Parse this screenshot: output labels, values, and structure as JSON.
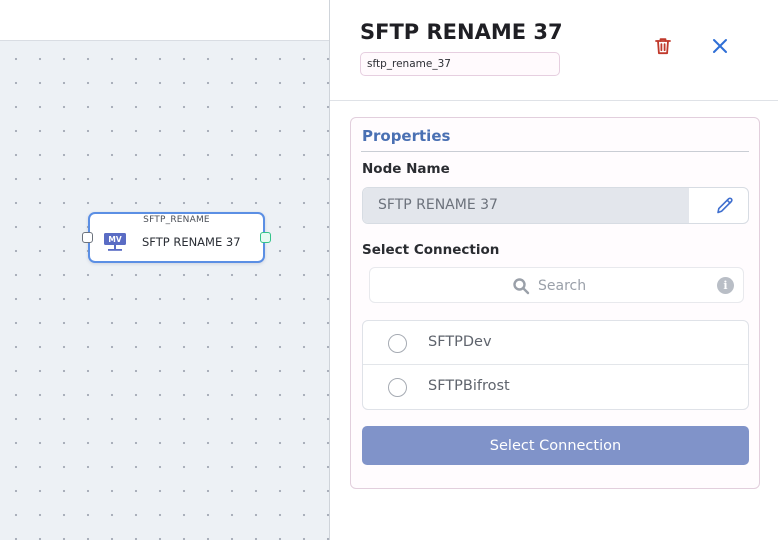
{
  "canvas": {
    "node": {
      "type_label": "SFTP_RENAME",
      "title": "SFTP RENAME 37",
      "icon": "mv-file-transfer-icon",
      "icon_text": "MV"
    }
  },
  "panel": {
    "title": "SFTP RENAME 37",
    "node_id": "sftp_rename_37",
    "delete_icon": "trash-icon",
    "close_icon": "close-icon",
    "properties": {
      "heading": "Properties",
      "node_name_label": "Node Name",
      "node_name_value": "SFTP RENAME 37",
      "edit_icon": "pencil-icon",
      "select_connection_label": "Select Connection",
      "search": {
        "placeholder": "Search",
        "icon": "search-icon",
        "info_icon": "info-icon",
        "info_text": "i"
      },
      "connections": [
        {
          "label": "SFTPDev",
          "selected": false
        },
        {
          "label": "SFTPBifrost",
          "selected": false
        }
      ],
      "select_button_label": "Select Connection"
    }
  },
  "colors": {
    "accent_blue": "#4a70b3",
    "button_blue": "#8093c9",
    "delete_red": "#c0392b",
    "close_blue": "#2f6fd6",
    "node_border": "#5b8fe4",
    "output_port": "#34c389"
  }
}
